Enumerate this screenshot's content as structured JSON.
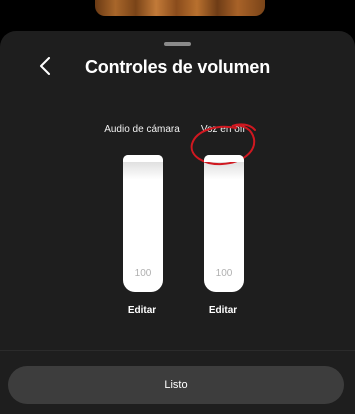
{
  "header": {
    "title": "Controles de volumen",
    "back_icon": "chevron-left-icon"
  },
  "channels": [
    {
      "label": "Audio de cámara",
      "volume": 100,
      "volume_text": "100",
      "edit_label": "Editar"
    },
    {
      "label": "Voz en off",
      "volume": 100,
      "volume_text": "100",
      "edit_label": "Editar"
    }
  ],
  "footer": {
    "done_label": "Listo"
  },
  "colors": {
    "sheet_background": "#1e1e1e",
    "slider_fill": "#ffffff",
    "annotation_circle": "#d01820",
    "done_button": "#3d3d3d"
  }
}
